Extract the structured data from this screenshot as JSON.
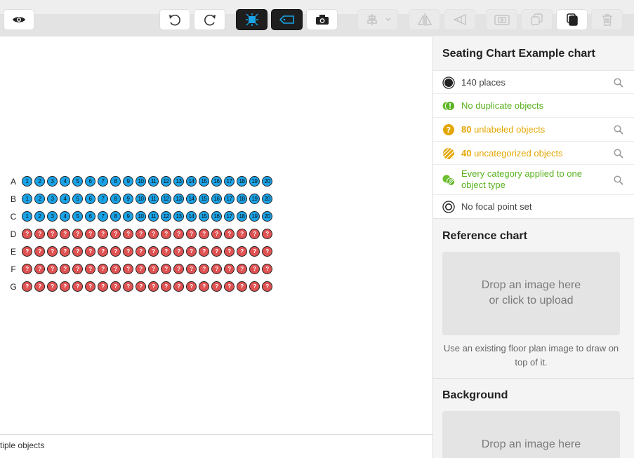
{
  "toolbar": {
    "buttons": [
      {
        "icon": "eye-icon"
      },
      {
        "icon": "undo-icon"
      },
      {
        "icon": "redo-icon"
      },
      {
        "icon": "select-mode-icon"
      },
      {
        "icon": "label-tag-icon"
      },
      {
        "icon": "camera-icon"
      },
      {
        "icon": "align-dropdown-icon"
      },
      {
        "icon": "flip-icon"
      },
      {
        "icon": "perspective-icon"
      },
      {
        "icon": "group-icon"
      },
      {
        "icon": "duplicate-icon"
      },
      {
        "icon": "copy-icon"
      },
      {
        "icon": "trash-icon"
      }
    ]
  },
  "canvas": {
    "seat_colors": {
      "labeled": "#1aa3e8",
      "unlabeled": "#e05252"
    },
    "rows": [
      {
        "label": "A",
        "labeled": true
      },
      {
        "label": "B",
        "labeled": true
      },
      {
        "label": "C",
        "labeled": true
      },
      {
        "label": "D",
        "labeled": false
      },
      {
        "label": "E",
        "labeled": false
      },
      {
        "label": "F",
        "labeled": false
      },
      {
        "label": "G",
        "labeled": false
      }
    ],
    "seat_numbers": [
      "1",
      "2",
      "3",
      "4",
      "5",
      "6",
      "7",
      "8",
      "9",
      "10",
      "11",
      "12",
      "13",
      "14",
      "15",
      "16",
      "17",
      "18",
      "19",
      "20"
    ],
    "unlabeled_mark": "?"
  },
  "statusbar": {
    "text": "tiple objects"
  },
  "panel": {
    "title": "Seating Chart Example chart",
    "stats": [
      {
        "count": "140",
        "text": " places",
        "color": "gray",
        "icon": "places-icon",
        "searchable": true
      },
      {
        "count": "",
        "text": "No duplicate objects",
        "color": "green",
        "icon": "check-duplicates-icon",
        "searchable": false
      },
      {
        "count": "80",
        "text": " unlabeled objects",
        "color": "amber",
        "icon": "unlabeled-icon",
        "searchable": true
      },
      {
        "count": "40",
        "text": " uncategorized objects",
        "color": "amber",
        "icon": "uncategorized-icon",
        "searchable": true
      },
      {
        "count": "",
        "text": "Every category applied to one object type",
        "color": "green",
        "icon": "categories-icon",
        "searchable": true
      },
      {
        "count": "",
        "text": "No focal point set",
        "color": "gray",
        "icon": "focal-point-icon",
        "searchable": false
      }
    ],
    "reference": {
      "title": "Reference chart",
      "drop_line1": "Drop an image here",
      "drop_line2": "or click to upload",
      "help": "Use an existing floor plan image to draw on top of it."
    },
    "background": {
      "title": "Background",
      "drop_line1": "Drop an image here"
    }
  }
}
